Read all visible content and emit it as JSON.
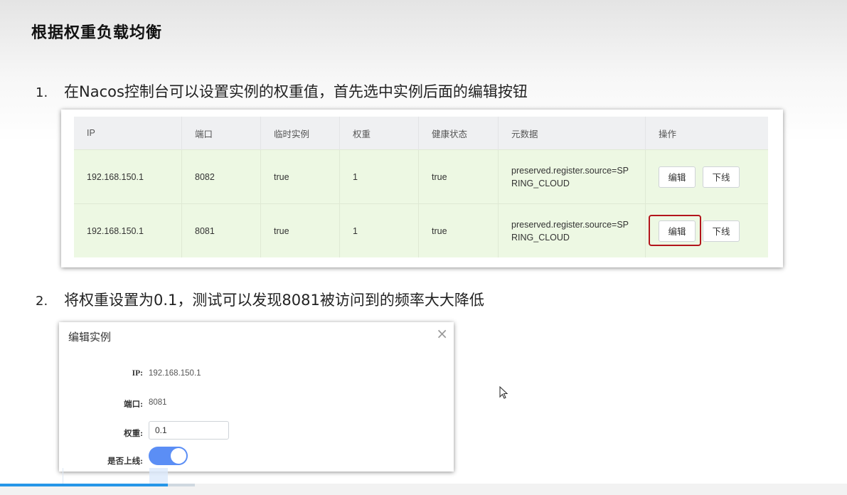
{
  "heading": "根据权重负载均衡",
  "steps": [
    {
      "num": "1.",
      "text": "在Nacos控制台可以设置实例的权重值，首先选中实例后面的编辑按钮"
    },
    {
      "num": "2.",
      "text": "将权重设置为0.1，测试可以发现8081被访问到的频率大大降低"
    }
  ],
  "table": {
    "headers": [
      "IP",
      "端口",
      "临时实例",
      "权重",
      "健康状态",
      "元数据",
      "操作"
    ],
    "rows": [
      {
        "ip": "192.168.150.1",
        "port": "8082",
        "ephemeral": "true",
        "weight": "1",
        "healthy": "true",
        "metadata": "preserved.register.source=SPRING_CLOUD",
        "edit": "编辑",
        "offline": "下线"
      },
      {
        "ip": "192.168.150.1",
        "port": "8081",
        "ephemeral": "true",
        "weight": "1",
        "healthy": "true",
        "metadata": "preserved.register.source=SPRING_CLOUD",
        "edit": "编辑",
        "offline": "下线"
      }
    ]
  },
  "dialog": {
    "title": "编辑实例",
    "close": "×",
    "ip_label": "IP:",
    "ip_value": "192.168.150.1",
    "port_label": "端口:",
    "port_value": "8081",
    "weight_label": "权重:",
    "weight_value": "0.1",
    "online_label": "是否上线:",
    "online": true
  },
  "video": {
    "progress": 0.198
  },
  "colors": {
    "accent": "#5b8ef5",
    "highlight": "#b3151c",
    "row_bg": "#edf8e3"
  }
}
